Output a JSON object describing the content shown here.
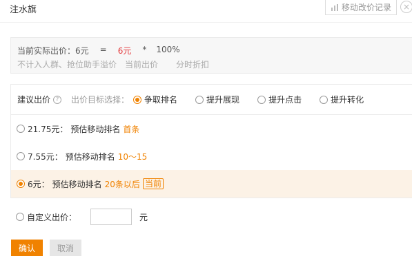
{
  "header": {
    "title": "注水旗",
    "history_label": "移动改价记录",
    "close_glyph": "×"
  },
  "summary": {
    "label": "当前实际出价：6元",
    "equals": "=",
    "value": "6元",
    "times": "*",
    "percent": "100%",
    "note_a": "不计入人群、抢位助手溢价",
    "note_b": "当前出价",
    "note_c": "分时折扣"
  },
  "target": {
    "suggest_label": "建议出价",
    "help_glyph": "?",
    "select_label": "出价目标选择：",
    "options": [
      "争取排名",
      "提升展现",
      "提升点击",
      "提升转化"
    ],
    "selected_index": 0
  },
  "bids": [
    {
      "price": "21.75元：",
      "desc": "预估移动排名",
      "rank": "首条",
      "badge": ""
    },
    {
      "price": "7.55元：",
      "desc": "预估移动排名",
      "rank": "10～15",
      "badge": ""
    },
    {
      "price": "6元：",
      "desc": "预估移动排名",
      "rank": "20条以后",
      "badge": "当前"
    }
  ],
  "selected_bid_index": 2,
  "custom": {
    "label": "自定义出价：",
    "value": "",
    "unit": "元"
  },
  "buttons": {
    "confirm": "确认",
    "cancel": "取消"
  },
  "colors": {
    "accent": "#f08200",
    "price_red": "#e4393c",
    "selected_row_bg": "#fcf2e6"
  }
}
